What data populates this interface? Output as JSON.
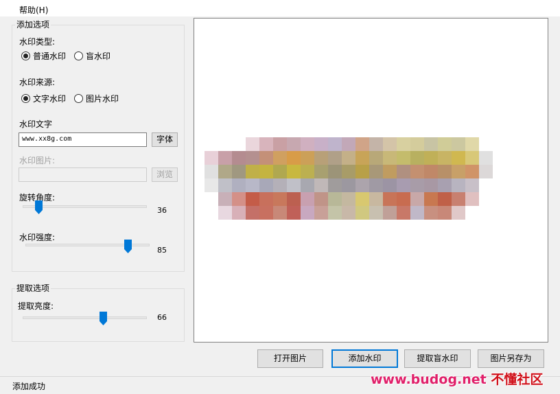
{
  "menu": {
    "help": "帮助(H)"
  },
  "add_options": {
    "title": "添加选项",
    "type_label": "水印类型:",
    "type_options": [
      "普通水印",
      "盲水印"
    ],
    "type_selected": "普通水印",
    "source_label": "水印来源:",
    "source_options": [
      "文字水印",
      "图片水印"
    ],
    "source_selected": "文字水印",
    "text_label": "水印文字",
    "text_value": "www.xx8g.com",
    "font_button": "字体",
    "image_label": "水印图片:",
    "image_value": "",
    "browse_button": "浏览",
    "rotation_label": "旋转角度:",
    "rotation_value": 36,
    "strength_label": "水印强度:",
    "strength_value": 85
  },
  "extract_options": {
    "title": "提取选项",
    "brightness_label": "提取亮度:",
    "brightness_value": 66
  },
  "buttons": {
    "open": "打开图片",
    "add": "添加水印",
    "extract": "提取盲水印",
    "save_as": "图片另存为"
  },
  "status": {
    "text": "添加成功"
  },
  "watermark_overlay": {
    "url": "www.budog.net",
    "name": "不懂社区"
  }
}
